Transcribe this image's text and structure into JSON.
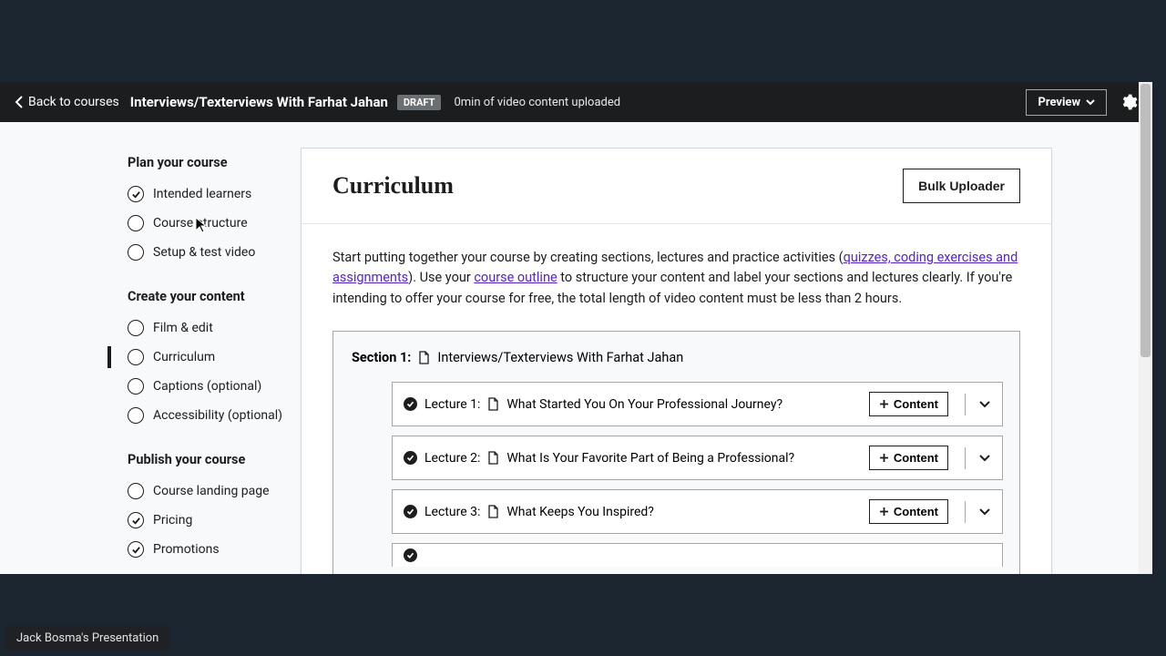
{
  "topbar": {
    "back_label": "Back to courses",
    "course_title": "Interviews/Texterviews With Farhat Jahan",
    "badge": "DRAFT",
    "upload_status": "0min of video content uploaded",
    "preview_label": "Preview"
  },
  "sidebar": {
    "groups": [
      {
        "title": "Plan your course",
        "items": [
          {
            "label": "Intended learners",
            "checked": true,
            "active": false
          },
          {
            "label": "Course structure",
            "checked": false,
            "active": false
          },
          {
            "label": "Setup & test video",
            "checked": false,
            "active": false
          }
        ]
      },
      {
        "title": "Create your content",
        "items": [
          {
            "label": "Film & edit",
            "checked": false,
            "active": false
          },
          {
            "label": "Curriculum",
            "checked": false,
            "active": true
          },
          {
            "label": "Captions (optional)",
            "checked": false,
            "active": false
          },
          {
            "label": "Accessibility (optional)",
            "checked": false,
            "active": false
          }
        ]
      },
      {
        "title": "Publish your course",
        "items": [
          {
            "label": "Course landing page",
            "checked": false,
            "active": false
          },
          {
            "label": "Pricing",
            "checked": true,
            "active": false
          },
          {
            "label": "Promotions",
            "checked": true,
            "active": false
          }
        ]
      }
    ]
  },
  "main": {
    "title": "Curriculum",
    "bulk_label": "Bulk Uploader",
    "intro_1": "Start putting together your course by creating sections, lectures and practice activities (",
    "intro_link1": "quizzes, coding exercises and assignments",
    "intro_2": "). Use your ",
    "intro_link2": "course outline",
    "intro_3": " to structure your content and label your sections and lectures clearly. If you're intending to offer your course for free, the total length of video content must be less than 2 hours.",
    "section": {
      "label": "Section 1:",
      "title": "Interviews/Texterviews With Farhat Jahan",
      "content_btn": "Content",
      "lectures": [
        {
          "label": "Lecture 1:",
          "title": "What Started You On Your Professional Journey?"
        },
        {
          "label": "Lecture 2:",
          "title": "What Is Your Favorite Part of Being a Professional?"
        },
        {
          "label": "Lecture 3:",
          "title": "What Keeps You Inspired?"
        }
      ]
    }
  },
  "footer": {
    "presentation": "Jack Bosma's Presentation"
  }
}
